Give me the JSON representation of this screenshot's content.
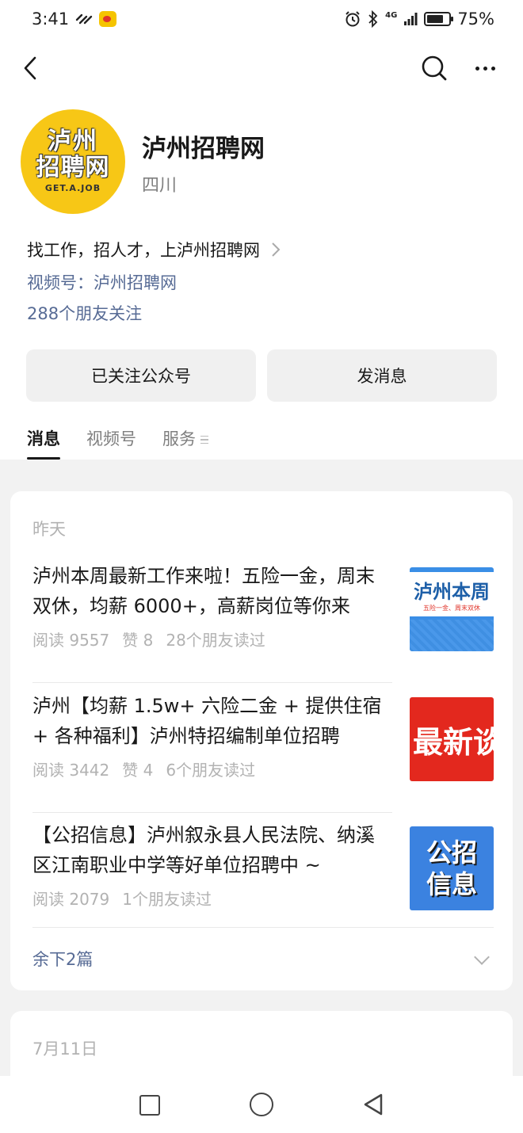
{
  "status_bar": {
    "time": "3:41",
    "network": "4G",
    "battery_text": "75%",
    "battery_level": 0.75,
    "icons": [
      "sync-icon",
      "weibo-icon",
      "alarm-icon",
      "bluetooth-icon",
      "signal-icon",
      "battery-icon"
    ]
  },
  "nav": {
    "back_icon": "chevron-left-icon",
    "search_icon": "search-icon",
    "more_icon": "more-horizontal-icon"
  },
  "profile": {
    "logo_line1": "泸州",
    "logo_line2": "招聘网",
    "logo_sub": "GET.A.JOB",
    "name": "泸州招聘网",
    "region": "四川",
    "intro": "找工作，招人才，上泸州招聘网",
    "channel": "视频号：泸州招聘网",
    "friends_follow": "288个朋友关注"
  },
  "actions": {
    "followed_label": "已关注公众号",
    "message_label": "发消息"
  },
  "tabs": [
    {
      "label": "消息",
      "active": true
    },
    {
      "label": "视频号",
      "active": false
    },
    {
      "label": "服务",
      "active": false
    }
  ],
  "feed": {
    "groups": [
      {
        "date": "昨天",
        "articles": [
          {
            "title": "泸州本周最新工作来啦！五险一金，周末双休，均薪 6000+，高薪岗位等你来",
            "reads": "阅读 9557",
            "likes": "赞 8",
            "friends": "28个朋友读过",
            "thumb_main": "泸州本周",
            "thumb_sub": "五险一金、周末双休"
          },
          {
            "title": "泸州【均薪 1.5w+ 六险二金 + 提供住宿 + 各种福利】泸州特招编制单位招聘",
            "reads": "阅读 3442",
            "likes": "赞 4",
            "friends": "6个朋友读过",
            "thumb_main": "最新谈"
          },
          {
            "title": "【公招信息】泸州叙永县人民法院、纳溪区江南职业中学等好单位招聘中 ~",
            "reads": "阅读 2079",
            "friends": "1个朋友读过",
            "thumb_line1": "公招",
            "thumb_line2": "信息"
          }
        ],
        "more_label": "余下2篇"
      },
      {
        "date": "7月11日"
      }
    ]
  },
  "colors": {
    "link": "#576b95",
    "logo_yellow": "#f7c716",
    "feed_bg": "#f2f2f2",
    "thumb_red": "#e3281e",
    "thumb_blue": "#3b82e0"
  }
}
